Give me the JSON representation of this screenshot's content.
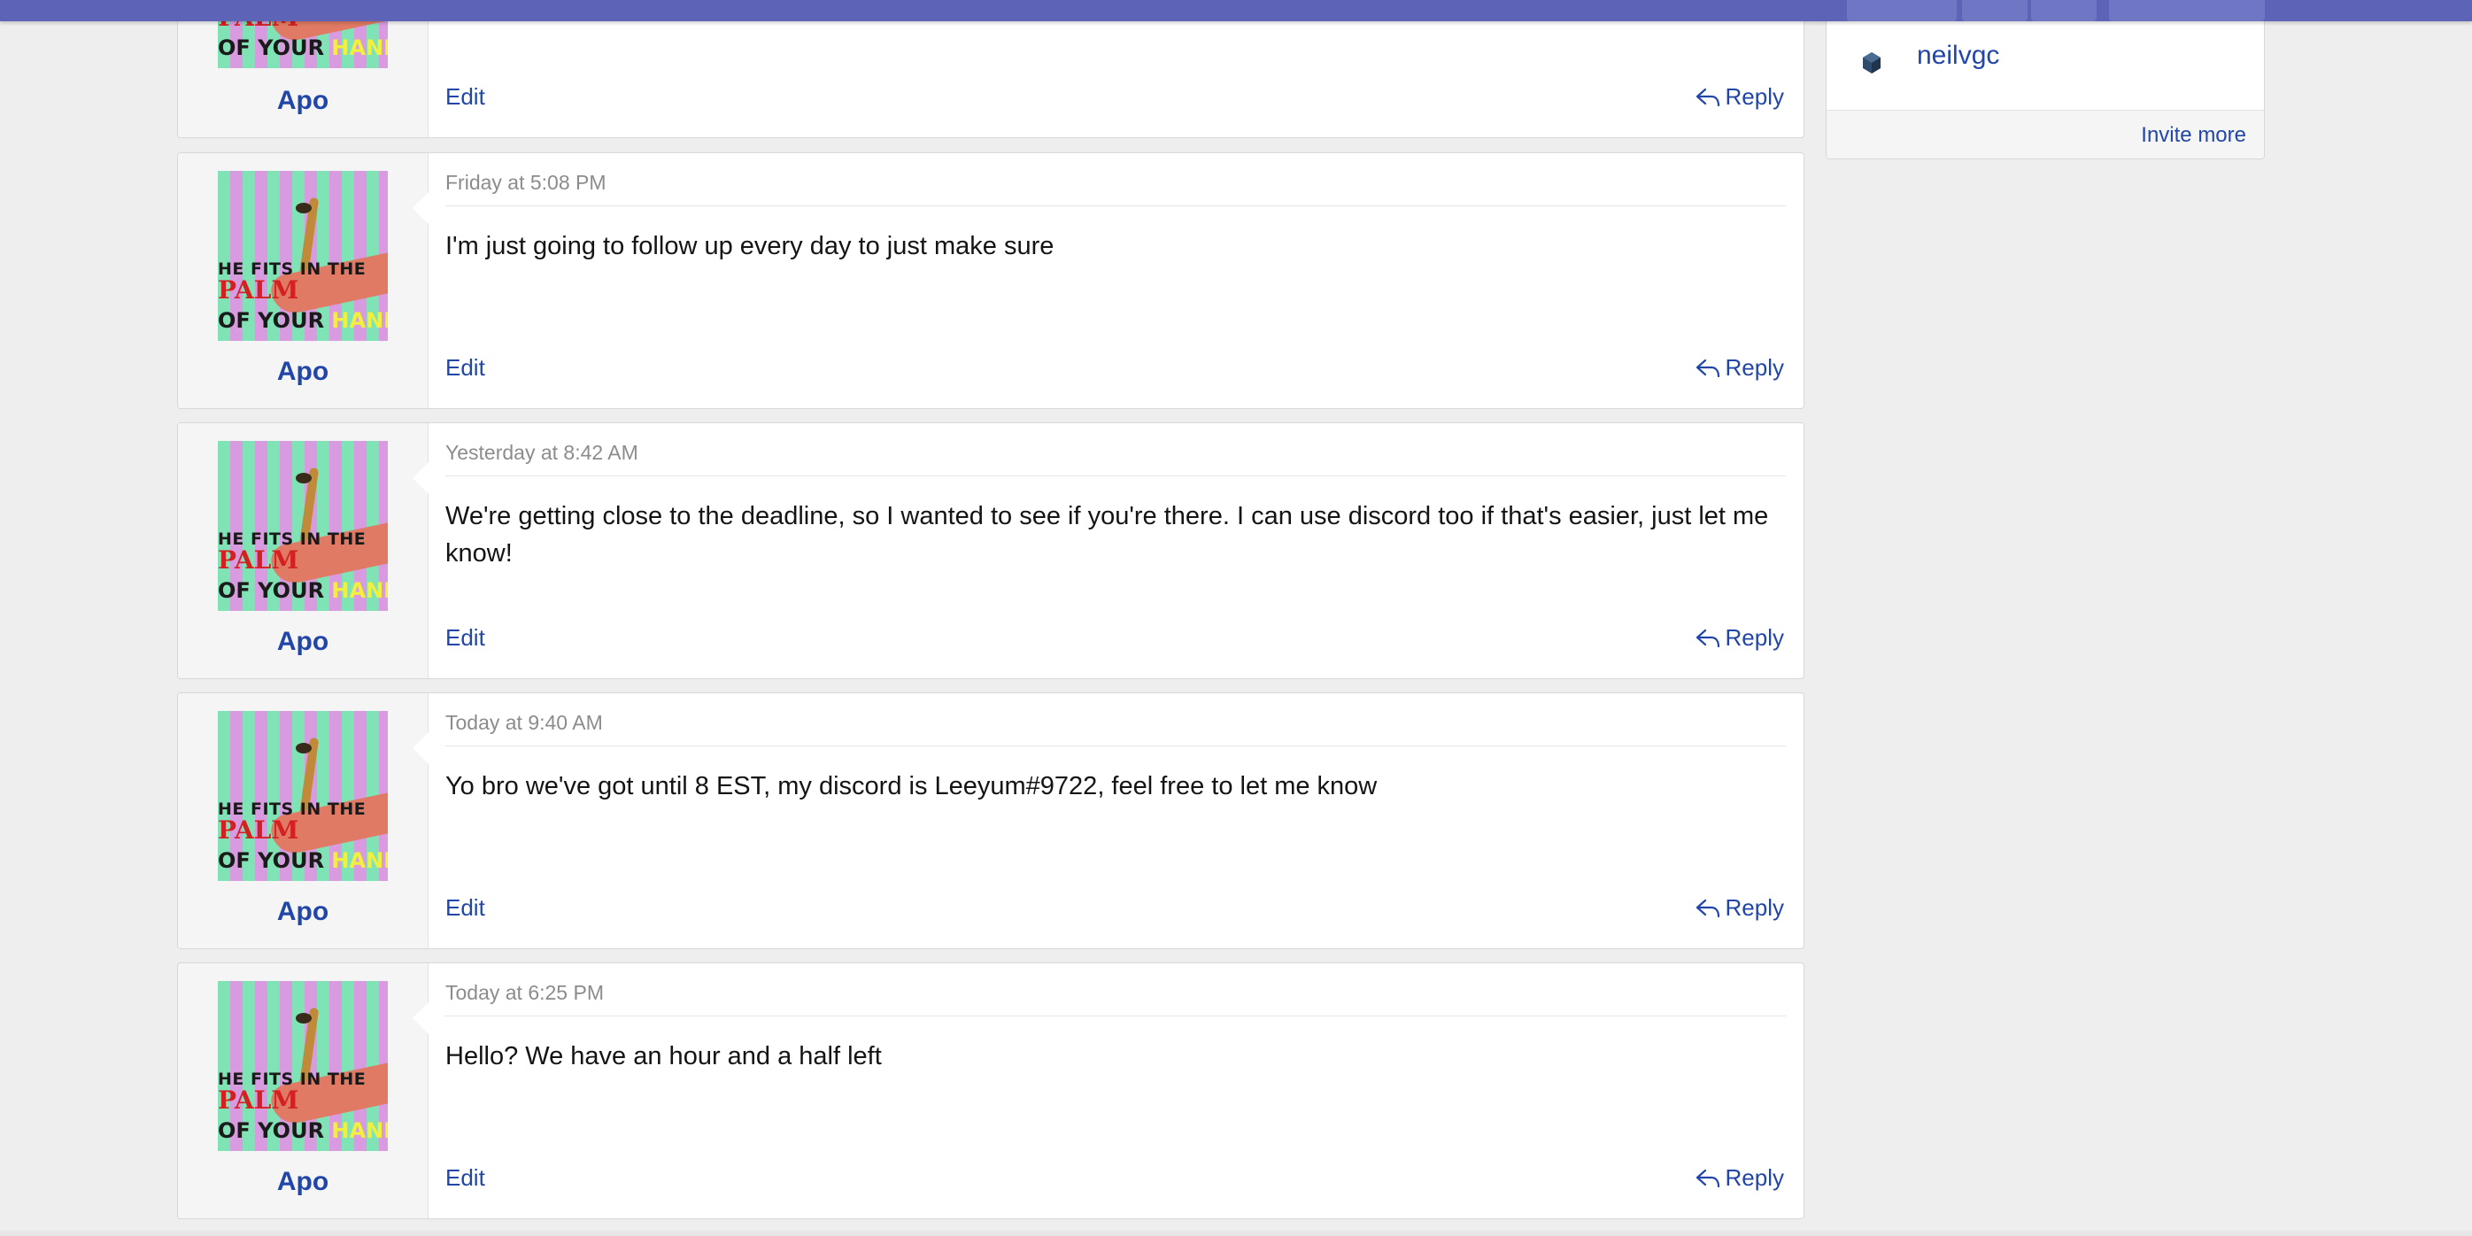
{
  "colors": {
    "topbar": "#5d64b8",
    "link": "#2246a8",
    "timestamp": "#8c8c8c",
    "background": "#eeeeee"
  },
  "messages": [
    {
      "user": "Apo",
      "time": "",
      "body": "",
      "edit_label": "Edit",
      "reply_label": "Reply"
    },
    {
      "user": "Apo",
      "time": "Friday at 5:08 PM",
      "body": "I'm just going to follow up every day to just make sure",
      "edit_label": "Edit",
      "reply_label": "Reply"
    },
    {
      "user": "Apo",
      "time": "Yesterday at 8:42 AM",
      "body": "We're getting close to the deadline, so I wanted to see if you're there. I can use discord too if that's easier, just let me know!",
      "edit_label": "Edit",
      "reply_label": "Reply"
    },
    {
      "user": "Apo",
      "time": "Today at 9:40 AM",
      "body": "Yo bro we've got until 8 EST, my discord is Leeyum#9722, feel free to let me know",
      "edit_label": "Edit",
      "reply_label": "Reply"
    },
    {
      "user": "Apo",
      "time": "Today at 6:25 PM",
      "body": "Hello? We have an hour and a half left",
      "edit_label": "Edit",
      "reply_label": "Reply"
    }
  ],
  "avatar_caption": {
    "line1": "HE FITS IN THE",
    "line2": "PALM",
    "line3_prefix": "OF YOUR",
    "line3_highlight": "HAND!"
  },
  "sidebar": {
    "participant": "neilvgc",
    "invite_label": "Invite more"
  }
}
